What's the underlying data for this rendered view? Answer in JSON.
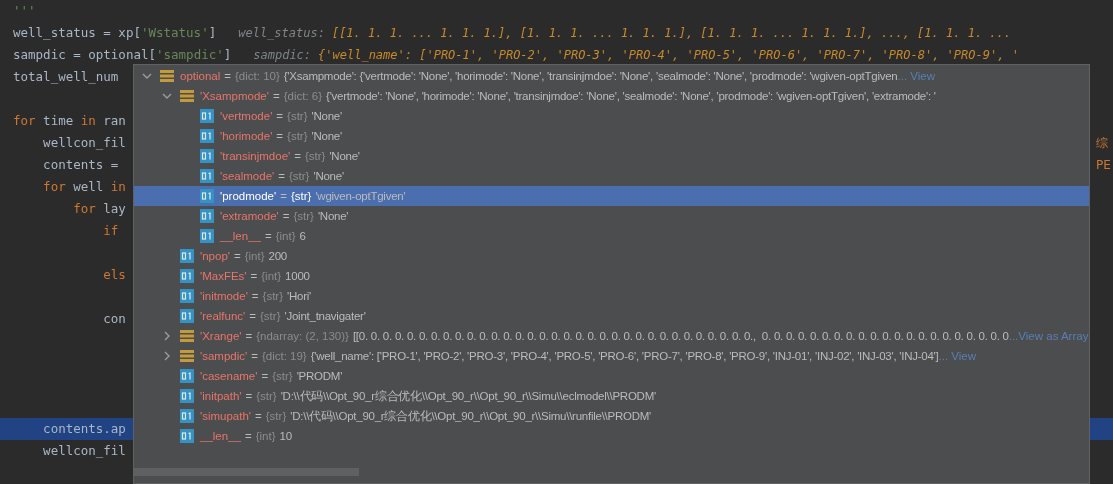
{
  "editor": {
    "lines": [
      {
        "selected": false,
        "tokens": [
          {
            "t": "'''",
            "kind": "string"
          }
        ]
      },
      {
        "selected": false,
        "tokens": [
          {
            "t": "well_status = xp[",
            "kind": "plain"
          },
          {
            "t": "'Wstatus'",
            "kind": "string"
          },
          {
            "t": "]",
            "kind": "plain"
          },
          {
            "t": "well_status:",
            "kind": "hint-name"
          },
          {
            "t": "[[1. 1. 1. ... 1. 1. 1.], [1. 1. 1. ... 1. 1. 1.], [1. 1. 1. ... 1. 1. 1.], ..., [1. 1. 1. ...",
            "kind": "hint-value"
          }
        ]
      },
      {
        "selected": false,
        "tokens": [
          {
            "t": "sampdic = optional[",
            "kind": "plain"
          },
          {
            "t": "'sampdic'",
            "kind": "string"
          },
          {
            "t": "]",
            "kind": "plain"
          },
          {
            "t": "sampdic:",
            "kind": "hint-name"
          },
          {
            "t": "{'well_name': ['PRO-1', 'PRO-2', 'PRO-3', 'PRO-4', 'PRO-5', 'PRO-6', 'PRO-7', 'PRO-8', 'PRO-9', '",
            "kind": "hint-value"
          }
        ]
      },
      {
        "selected": false,
        "tokens": [
          {
            "t": "total_well_num",
            "kind": "plain"
          }
        ]
      },
      {
        "selected": false
      },
      {
        "selected": false,
        "tokens": [
          {
            "t": "for",
            "kind": "keyword"
          },
          {
            "t": " time ",
            "kind": "plain"
          },
          {
            "t": "in",
            "kind": "keyword"
          },
          {
            "t": " ran",
            "kind": "plain"
          }
        ]
      },
      {
        "selected": false,
        "tokens": [
          {
            "t": "    wellcon_fil",
            "kind": "plain"
          },
          {
            "t": "综",
            "kind": "right-string"
          }
        ]
      },
      {
        "selected": false,
        "tokens": [
          {
            "t": "    contents = ",
            "kind": "plain"
          },
          {
            "t": "PE",
            "kind": "right-string"
          }
        ]
      },
      {
        "selected": false,
        "tokens": [
          {
            "t": "    for",
            "kind": "keyword"
          },
          {
            "t": " well ",
            "kind": "plain"
          },
          {
            "t": "in",
            "kind": "keyword"
          }
        ]
      },
      {
        "selected": false,
        "tokens": [
          {
            "t": "        for",
            "kind": "keyword"
          },
          {
            "t": " lay",
            "kind": "plain"
          }
        ]
      },
      {
        "selected": false,
        "tokens": [
          {
            "t": "            if",
            "kind": "keyword"
          }
        ]
      },
      {
        "selected": false
      },
      {
        "selected": false,
        "tokens": [
          {
            "t": "            els",
            "kind": "keyword"
          }
        ]
      },
      {
        "selected": false
      },
      {
        "selected": false,
        "tokens": [
          {
            "t": "            con",
            "kind": "plain"
          }
        ]
      },
      {
        "selected": false
      },
      {
        "selected": false
      },
      {
        "selected": false
      },
      {
        "selected": false
      },
      {
        "selected": true,
        "tokens": [
          {
            "t": "    contents.ap",
            "kind": "plain"
          }
        ]
      },
      {
        "selected": false,
        "tokens": [
          {
            "t": "    wellcon_fil",
            "kind": "plain"
          }
        ]
      }
    ]
  },
  "popup": {
    "tree": [
      {
        "name": "optional",
        "eq": "=",
        "kind": "dict",
        "type": "{dict: 10}",
        "value": "{'Xsampmode': {'vertmode': 'None', 'horimode': 'None', 'transinjmdoe': 'None', 'sealmode': 'None', 'prodmode': 'wgiven-optTgiven",
        "link": "... View",
        "expanded": true,
        "selected": false,
        "children": [
          {
            "name": "'Xsampmode'",
            "eq": "=",
            "kind": "dict",
            "type": "{dict: 6}",
            "value": "{'vertmode': 'None', 'horimode': 'None', 'transinjmdoe': 'None', 'sealmode': 'None', 'prodmode': 'wgiven-optTgiven', 'extramode': '",
            "expanded": true,
            "selected": false,
            "children": [
              {
                "name": "'vertmode'",
                "eq": "=",
                "kind": "scalar",
                "type": "{str}",
                "value": "'None'",
                "selected": false
              },
              {
                "name": "'horimode'",
                "eq": "=",
                "kind": "scalar",
                "type": "{str}",
                "value": "'None'",
                "selected": false
              },
              {
                "name": "'transinjmdoe'",
                "eq": "=",
                "kind": "scalar",
                "type": "{str}",
                "value": "'None'",
                "selected": false
              },
              {
                "name": "'sealmode'",
                "eq": "=",
                "kind": "scalar",
                "type": "{str}",
                "value": "'None'",
                "selected": false
              },
              {
                "name": "'prodmode'",
                "eq": "=",
                "kind": "scalar",
                "type": "{str}",
                "value": "'wgiven-optTgiven'",
                "selected": true
              },
              {
                "name": "'extramode'",
                "eq": "=",
                "kind": "scalar",
                "type": "{str}",
                "value": "'None'",
                "selected": false
              },
              {
                "name": "__len__",
                "eq": "=",
                "kind": "scalar",
                "type": "{int}",
                "value": "6",
                "selected": false
              }
            ]
          },
          {
            "name": "'npop'",
            "eq": "=",
            "kind": "scalar",
            "type": "{int}",
            "value": "200",
            "selected": false
          },
          {
            "name": "'MaxFEs'",
            "eq": "=",
            "kind": "scalar",
            "type": "{int}",
            "value": "1000",
            "selected": false
          },
          {
            "name": "'initmode'",
            "eq": "=",
            "kind": "scalar",
            "type": "{str}",
            "value": "'Hori'",
            "selected": false
          },
          {
            "name": "'realfunc'",
            "eq": "=",
            "kind": "scalar",
            "type": "{str}",
            "value": "'Joint_tnavigater'",
            "selected": false
          },
          {
            "name": "'Xrange'",
            "eq": "=",
            "kind": "dict",
            "type": "{ndarray: (2, 130)}",
            "value": "[[0. 0. 0. 0. 0. 0. 0. 0. 0. 0. 0. 0. 0. 0. 0. 0. 0. 0. 0. 0. 0. 0. 0. 0. 0. 0. 0. 0. 0. 0. 0. 0. 0.,  0. 0. 0. 0. 0. 0. 0. 0. 0. 0. 0. 0. 0. 0. 0. 0. 0. 0. 0. 0. 0",
            "link": "...View as Array",
            "expanded": false,
            "selected": false
          },
          {
            "name": "'sampdic'",
            "eq": "=",
            "kind": "dict",
            "type": "{dict: 19}",
            "value": "{'well_name': ['PRO-1', 'PRO-2', 'PRO-3', 'PRO-4', 'PRO-5', 'PRO-6', 'PRO-7', 'PRO-8', 'PRO-9', 'INJ-01', 'INJ-02', 'INJ-03', 'INJ-04']",
            "link": "... View",
            "expanded": false,
            "selected": false
          },
          {
            "name": "'casename'",
            "eq": "=",
            "kind": "scalar",
            "type": "{str}",
            "value": "'PRODM'",
            "selected": false
          },
          {
            "name": "'initpath'",
            "eq": "=",
            "kind": "scalar",
            "type": "{str}",
            "value": "'D:\\\\代码\\\\Opt_90_r综合优化\\\\Opt_90_r\\\\Opt_90_r\\\\Simu\\\\eclmodel\\\\PRODM'",
            "selected": false
          },
          {
            "name": "'simupath'",
            "eq": "=",
            "kind": "scalar",
            "type": "{str}",
            "value": "'D:\\\\代码\\\\Opt_90_r综合优化\\\\Opt_90_r\\\\Opt_90_r\\\\Simu\\\\runfile\\\\PRODM'",
            "selected": false
          },
          {
            "name": "__len__",
            "eq": "=",
            "kind": "scalar",
            "type": "{int}",
            "value": "10",
            "selected": false
          }
        ]
      }
    ]
  }
}
